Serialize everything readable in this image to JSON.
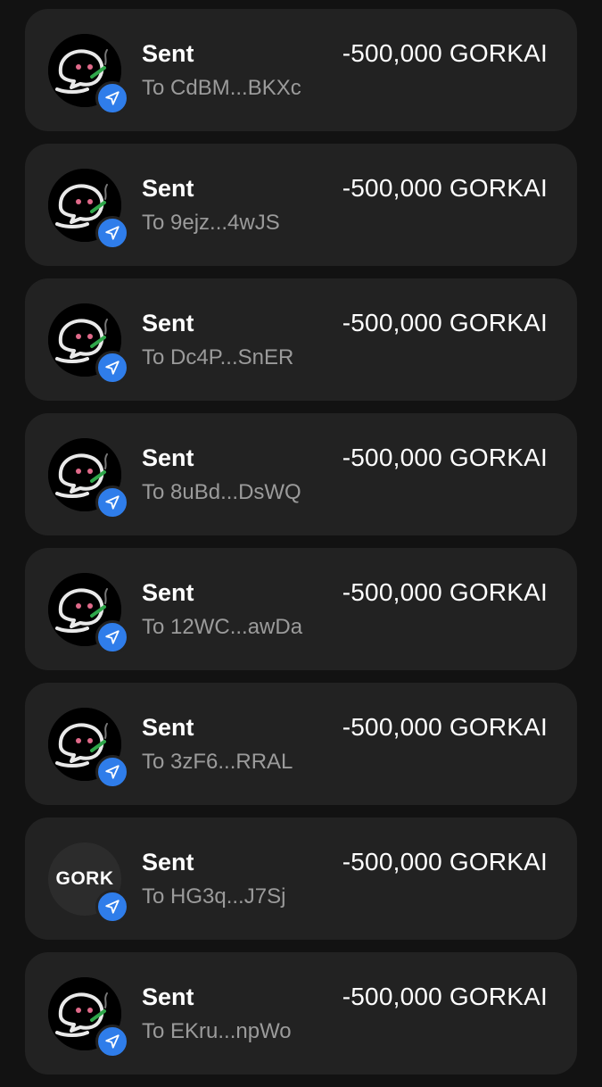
{
  "transactions": [
    {
      "title": "Sent",
      "amount": "-500,000 GORKAI",
      "recipient": "To CdBM...BKXc",
      "avatar": "ghost-icon",
      "avatar_text": ""
    },
    {
      "title": "Sent",
      "amount": "-500,000 GORKAI",
      "recipient": "To 9ejz...4wJS",
      "avatar": "ghost-icon",
      "avatar_text": ""
    },
    {
      "title": "Sent",
      "amount": "-500,000 GORKAI",
      "recipient": "To Dc4P...SnER",
      "avatar": "ghost-icon",
      "avatar_text": ""
    },
    {
      "title": "Sent",
      "amount": "-500,000 GORKAI",
      "recipient": "To 8uBd...DsWQ",
      "avatar": "ghost-icon",
      "avatar_text": ""
    },
    {
      "title": "Sent",
      "amount": "-500,000 GORKAI",
      "recipient": "To 12WC...awDa",
      "avatar": "ghost-icon",
      "avatar_text": ""
    },
    {
      "title": "Sent",
      "amount": "-500,000 GORKAI",
      "recipient": "To 3zF6...RRAL",
      "avatar": "ghost-icon",
      "avatar_text": ""
    },
    {
      "title": "Sent",
      "amount": "-500,000 GORKAI",
      "recipient": "To HG3q...J7Sj",
      "avatar": "text",
      "avatar_text": "GORK"
    },
    {
      "title": "Sent",
      "amount": "-500,000 GORKAI",
      "recipient": "To EKru...npWo",
      "avatar": "ghost-icon",
      "avatar_text": ""
    }
  ],
  "colors": {
    "background": "#121212",
    "card": "#222222",
    "badge": "#2f7dea",
    "secondary_text": "#9b9b9b"
  },
  "icons": {
    "badge": "send-icon"
  }
}
